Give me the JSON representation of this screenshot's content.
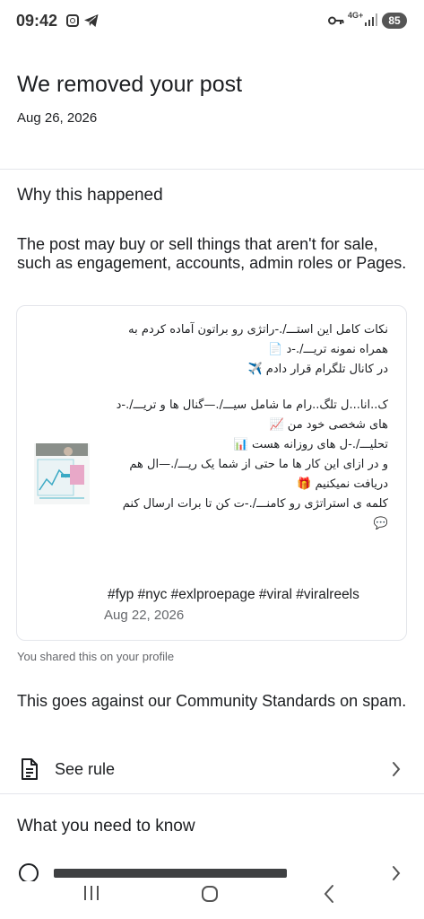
{
  "status_bar": {
    "time": "09:42",
    "network": "4G+",
    "battery": "85",
    "icons": [
      "instagram-icon",
      "telegram-icon",
      "key-icon",
      "signal-icon",
      "battery-icon"
    ]
  },
  "header": {
    "title": "We removed your post",
    "date": "Aug 26, 2026"
  },
  "why": {
    "heading": "Why this happened",
    "body": "The post may buy or sell things that aren't for sale, such as engagement, accounts, admin roles or Pages."
  },
  "post": {
    "lines_block1": [
      "نکات کامل این استـــ/.-راتژی رو براتون آماده کردم به",
      "همراه نمونه تریـــ/.-د 📄",
      "در کانال تلگرام قرار دادم ✈️"
    ],
    "lines_block2": [
      "ک..انا...ل تلگ..رام ما شامل سیـــ/.—گنال ها و تریـــ/.-د",
      "های شخصی خود من 📈",
      "تحلیـــ/.-ل های روزانه هست 📊",
      "و در ازای این کار ها ما حتی از شما یک ریـــ/.—ال هم",
      "دریافت نمیکنیم 🎁",
      "کلمه ی استراتژی رو کامنـــ/.-ت کن تا برات ارسال کنم",
      "💬"
    ],
    "hashtags": "#fyp #nyc #exlproepage #viral #viralreels",
    "date": "Aug 22, 2026"
  },
  "shared_note": "You shared this on your profile",
  "standards_text": "This goes against our Community Standards on spam.",
  "see_rule_label": "See rule",
  "need_to_know_heading": "What you need to know",
  "colors": {
    "text": "#1c1e21",
    "secondary": "#65676b",
    "divider": "#e4e6eb"
  }
}
